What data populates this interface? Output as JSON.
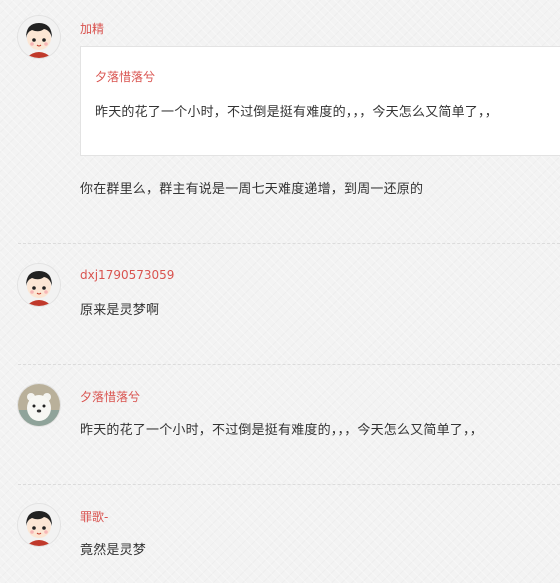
{
  "comments": [
    {
      "author": "加精",
      "avatar": "avatar-boy-icon",
      "quote": {
        "author": "夕落惜落兮",
        "text": "昨天的花了一个小时，不过倒是挺有难度的，，，今天怎么又简单了，，"
      },
      "text": "你在群里么，群主有说是一周七天难度递增，到周一还原的"
    },
    {
      "author": "dxj1790573059",
      "avatar": "avatar-boy-icon",
      "text": "原来是灵梦啊"
    },
    {
      "author": "夕落惜落兮",
      "avatar": "avatar-bear-icon",
      "text": "昨天的花了一个小时，不过倒是挺有难度的，，，今天怎么又简单了，，"
    },
    {
      "author": "罪歌-",
      "avatar": "avatar-boy-icon",
      "text": "竟然是灵梦"
    }
  ],
  "colors": {
    "author": "#d9534f",
    "text": "#333333",
    "background": "#f3f3f3"
  }
}
